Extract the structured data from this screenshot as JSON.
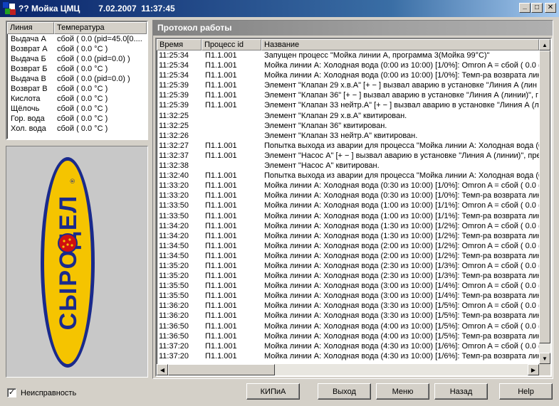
{
  "window": {
    "title": "?? Мойка ЦМЦ",
    "datetime": "7.02.2007  11:37:45",
    "min": "_",
    "max": "□",
    "close": "✕"
  },
  "left_table": {
    "headers": [
      "Линия",
      "Температура"
    ],
    "rows": [
      {
        "line": "Выдача А",
        "temp": "сбой ( 0.0 (pid=45.0[0...."
      },
      {
        "line": "Возврат А",
        "temp": "сбой ( 0.0 °C )"
      },
      {
        "line": "Выдача Б",
        "temp": "сбой ( 0.0 (pid=0.0) )"
      },
      {
        "line": "Возврат Б",
        "temp": "сбой ( 0.0 °C )"
      },
      {
        "line": "Выдача В",
        "temp": "сбой ( 0.0 (pid=0.0) )"
      },
      {
        "line": "Возврат В",
        "temp": "сбой ( 0.0 °C )"
      },
      {
        "line": "Кислота",
        "temp": "сбой ( 0.0 °C )"
      },
      {
        "line": "Щёлочь",
        "temp": "сбой ( 0.0 °C )"
      },
      {
        "line": "Гор. вода",
        "temp": "сбой ( 0.0 °C )"
      },
      {
        "line": "Хол. вода",
        "temp": "сбой ( 0.0 °C )"
      }
    ]
  },
  "logo": {
    "text": "СЫРОДЕЛ",
    "mark": "®"
  },
  "protocol": {
    "title": "Протокол работы",
    "headers": [
      "Время",
      "Процесс id",
      "Название"
    ],
    "rows": [
      {
        "time": "11:25:34",
        "pid": "П1.1.001",
        "name": "Запущен процесс \"Мойка линии А, программа 3(Мойка 99°C)\""
      },
      {
        "time": "11:25:34",
        "pid": "П1.1.001",
        "name": "Мойка линии А: Холодная вода (0:00 из 10:00) [1/0%]: Omron A = сбой ( 0.0 (pi"
      },
      {
        "time": "11:25:34",
        "pid": "П1.1.001",
        "name": "Мойка линии А: Холодная вода (0:00 из 10:00) [1/0%]: Темп-ра возврата лин"
      },
      {
        "time": "11:25:39",
        "pid": "П1.1.001",
        "name": "Элемент \"Клапан 29 х.в.А\" [+ −  ] вызвал аварию в установке \"Линия А (лин"
      },
      {
        "time": "11:25:39",
        "pid": "П1.1.001",
        "name": "Элемент \"Клапан 36\" [+ −  ] вызвал аварию в установке \"Линия А (линии)\", г"
      },
      {
        "time": "11:25:39",
        "pid": "П1.1.001",
        "name": "Элемент \"Клапан 33 нейтр.А\" [+ −  ] вызвал аварию в установке \"Линия А (л"
      },
      {
        "time": "11:32:25",
        "pid": "",
        "name": "Элемент \"Клапан 29 х.в.А\" квитирован."
      },
      {
        "time": "11:32:25",
        "pid": "",
        "name": "Элемент \"Клапан 36\" квитирован."
      },
      {
        "time": "11:32:26",
        "pid": "",
        "name": "Элемент \"Клапан 33 нейтр.А\" квитирован."
      },
      {
        "time": "11:32:27",
        "pid": "П1.1.001",
        "name": "Попытка выхода из аварии для процесса \"Мойка линии А: Холодная вода (0)"
      },
      {
        "time": "11:32:37",
        "pid": "П1.1.001",
        "name": "Элемент \"Насос А\" [+ −  ] вызвал аварию в установке \"Линия А (линии)\", пре"
      },
      {
        "time": "11:32:38",
        "pid": "",
        "name": "Элемент \"Насос А\" квитирован."
      },
      {
        "time": "11:32:40",
        "pid": "П1.1.001",
        "name": "Попытка выхода из аварии для процесса \"Мойка линии А: Холодная вода (0"
      },
      {
        "time": "11:33:20",
        "pid": "П1.1.001",
        "name": "Мойка линии А: Холодная вода (0:30 из 10:00) [1/0%]: Omron A = сбой ( 0.0 (pi"
      },
      {
        "time": "11:33:20",
        "pid": "П1.1.001",
        "name": "Мойка линии А: Холодная вода (0:30 из 10:00) [1/0%]: Темп-ра возврата лин"
      },
      {
        "time": "11:33:50",
        "pid": "П1.1.001",
        "name": "Мойка линии А: Холодная вода (1:00 из 10:00) [1/1%]: Omron A = сбой ( 0.0 (pi"
      },
      {
        "time": "11:33:50",
        "pid": "П1.1.001",
        "name": "Мойка линии А: Холодная вода (1:00 из 10:00) [1/1%]: Темп-ра возврата лин"
      },
      {
        "time": "11:34:20",
        "pid": "П1.1.001",
        "name": "Мойка линии А: Холодная вода (1:30 из 10:00) [1/2%]: Omron A = сбой ( 0.0 (pi"
      },
      {
        "time": "11:34:20",
        "pid": "П1.1.001",
        "name": "Мойка линии А: Холодная вода (1:30 из 10:00) [1/2%]: Темп-ра возврата лин"
      },
      {
        "time": "11:34:50",
        "pid": "П1.1.001",
        "name": "Мойка линии А: Холодная вода (2:00 из 10:00) [1/2%]: Omron A = сбой ( 0.0 (pi"
      },
      {
        "time": "11:34:50",
        "pid": "П1.1.001",
        "name": "Мойка линии А: Холодная вода (2:00 из 10:00) [1/2%]: Темп-ра возврата лин"
      },
      {
        "time": "11:35:20",
        "pid": "П1.1.001",
        "name": "Мойка линии А: Холодная вода (2:30 из 10:00) [1/3%]: Omron A = сбой ( 0.0 (pi"
      },
      {
        "time": "11:35:20",
        "pid": "П1.1.001",
        "name": "Мойка линии А: Холодная вода (2:30 из 10:00) [1/3%]: Темп-ра возврата лин"
      },
      {
        "time": "11:35:50",
        "pid": "П1.1.001",
        "name": "Мойка линии А: Холодная вода (3:00 из 10:00) [1/4%]: Omron A = сбой ( 0.0 (pi"
      },
      {
        "time": "11:35:50",
        "pid": "П1.1.001",
        "name": "Мойка линии А: Холодная вода (3:00 из 10:00) [1/4%]: Темп-ра возврата лин"
      },
      {
        "time": "11:36:20",
        "pid": "П1.1.001",
        "name": "Мойка линии А: Холодная вода (3:30 из 10:00) [1/5%]: Omron A = сбой ( 0.0 (pi"
      },
      {
        "time": "11:36:20",
        "pid": "П1.1.001",
        "name": "Мойка линии А: Холодная вода (3:30 из 10:00) [1/5%]: Темп-ра возврата лин"
      },
      {
        "time": "11:36:50",
        "pid": "П1.1.001",
        "name": "Мойка линии А: Холодная вода (4:00 из 10:00) [1/5%]: Omron A = сбой ( 0.0 (pi"
      },
      {
        "time": "11:36:50",
        "pid": "П1.1.001",
        "name": "Мойка линии А: Холодная вода (4:00 из 10:00) [1/5%]: Темп-ра возврата лин"
      },
      {
        "time": "11:37:20",
        "pid": "П1.1.001",
        "name": "Мойка линии А: Холодная вода (4:30 из 10:00) [1/6%]: Omron A = сбой ( 0.0 (pi"
      },
      {
        "time": "11:37:20",
        "pid": "П1.1.001",
        "name": "Мойка линии А: Холодная вода (4:30 из 10:00) [1/6%]: Темп-ра возврата лин"
      }
    ]
  },
  "footer": {
    "checkbox_label": "Неисправность",
    "checkbox_checked": "✓",
    "buttons": {
      "kip": "КИПиА",
      "exit": "Выход",
      "menu": "Меню",
      "back": "Назад",
      "help": "Help"
    }
  },
  "colors": {
    "logo_yellow": "#f5c400",
    "logo_blue": "#1a2a8c",
    "logo_red": "#d01010"
  }
}
